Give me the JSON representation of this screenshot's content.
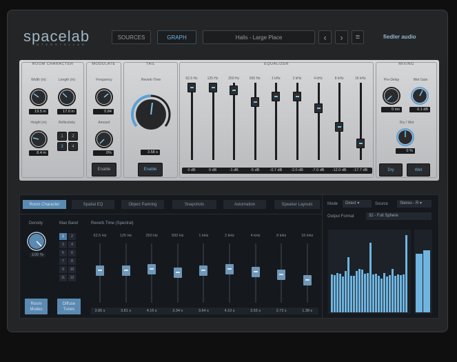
{
  "header": {
    "logo": "spacelab",
    "logo_sub": "INTERSTELLAR",
    "sources_label": "SOURCES",
    "graph_label": "GRAPH",
    "preset": "Halls - Large Place",
    "brand": "fiedler audio",
    "prev": "‹",
    "next": "›",
    "menu": "≡"
  },
  "room_character": {
    "title": "ROOM CHARACTER",
    "width_label": "Width (m)",
    "width_value": "19.5 m",
    "length_label": "Length (m)",
    "length_value": "17.0 m",
    "height_label": "Height (m)",
    "height_value": "8.4 m",
    "reflectivity_label": "Reflectivity",
    "reflectivity_buttons": [
      "1",
      "2",
      "3",
      "4"
    ],
    "reflectivity_selected": "3"
  },
  "modulate": {
    "title": "MODULATE",
    "frequency_label": "Frequency",
    "frequency_value": "0.84",
    "amount_label": "Amount",
    "amount_value": "0%",
    "enable_label": "Enable"
  },
  "tail": {
    "title": "TAIL",
    "reverb_time_label": "Reverb Time",
    "reverb_time_value": "3.58 s",
    "enable_label": "Enable"
  },
  "equalizer": {
    "title": "EQUALIZER",
    "bands": [
      {
        "freq": "62.5 Hz",
        "value": "0 dB",
        "level": 1.0
      },
      {
        "freq": "125 Hz",
        "value": "0 dB",
        "level": 1.0
      },
      {
        "freq": "250 Hz",
        "value": "-1 dB",
        "level": 0.96
      },
      {
        "freq": "500 Hz",
        "value": "-5 dB",
        "level": 0.8
      },
      {
        "freq": "1 kHz",
        "value": "-0.7 dB",
        "level": 0.88
      },
      {
        "freq": "2 kHz",
        "value": "-2.0 dB",
        "level": 0.88
      },
      {
        "freq": "4 kHz",
        "value": "-7.0 dB",
        "level": 0.71
      },
      {
        "freq": "8 kHz",
        "value": "-12.0 dB",
        "level": 0.46
      },
      {
        "freq": "16 kHz",
        "value": "-17.7 dB",
        "level": 0.23
      }
    ]
  },
  "mixing": {
    "title": "MIXING",
    "predelay_label": "Pre-Delay",
    "predelay_value": "0 ms",
    "wetgain_label": "Wet Gain",
    "wetgain_value": "0.1 dB",
    "drywet_label": "Dry / Wet",
    "drywet_value": "0 %",
    "dry_label": "Dry",
    "wet_label": "Wet"
  },
  "bottom": {
    "tabs": [
      "Room Character",
      "Spatial EQ",
      "Object Panning",
      "Snapshots",
      "Automation",
      "Speaker Layouts"
    ],
    "active_tab": 0,
    "density_label": "Density",
    "density_value": "100 %",
    "max_band_label": "Max Band",
    "max_band_buttons": [
      "1",
      "2",
      "3",
      "4",
      "5",
      "6",
      "7",
      "8",
      "9",
      "10",
      "11",
      "12"
    ],
    "max_band_selected": "1",
    "reverb_time_label": "Reverb Time (Spectral)",
    "bands": [
      {
        "freq": "62.5 Hz",
        "value": "3.86 s",
        "level": 0.6
      },
      {
        "freq": "125 Hz",
        "value": "3.81 s",
        "level": 0.6
      },
      {
        "freq": "250 Hz",
        "value": "4.16 s",
        "level": 0.62
      },
      {
        "freq": "500 Hz",
        "value": "3.34 s",
        "level": 0.56
      },
      {
        "freq": "1 kHz",
        "value": "3.64 s",
        "level": 0.6
      },
      {
        "freq": "2 kHz",
        "value": "4.10 s",
        "level": 0.62
      },
      {
        "freq": "4 kHz",
        "value": "3.55 s",
        "level": 0.58
      },
      {
        "freq": "8 kHz",
        "value": "2.73 s",
        "level": 0.52
      },
      {
        "freq": "16 kHz",
        "value": "1.38 s",
        "level": 0.42
      }
    ],
    "room_modes_label": "Room Modes",
    "diffuse_tunes_label": "Diffuse Tunes",
    "mode_label": "Mode",
    "mode_value": "Direct",
    "source_label": "Source",
    "source_value": "Stereo - R",
    "output_format_label": "Output Format",
    "output_format_value": "32 - Full Sphere",
    "spectrum_levels": [
      0.48,
      0.47,
      0.5,
      0.49,
      0.45,
      0.52,
      0.7,
      0.46,
      0.46,
      0.52,
      0.55,
      0.54,
      0.49,
      0.5,
      0.88,
      0.48,
      0.49,
      0.46,
      0.43,
      0.5,
      0.45,
      0.47,
      0.55,
      0.46,
      0.48,
      0.47,
      0.48,
      0.97
    ],
    "meter_levels": [
      0.85,
      0.9
    ]
  },
  "colors": {
    "accent": "#6ab8e8",
    "panel": "#c9cacc",
    "dark": "#15191e"
  }
}
